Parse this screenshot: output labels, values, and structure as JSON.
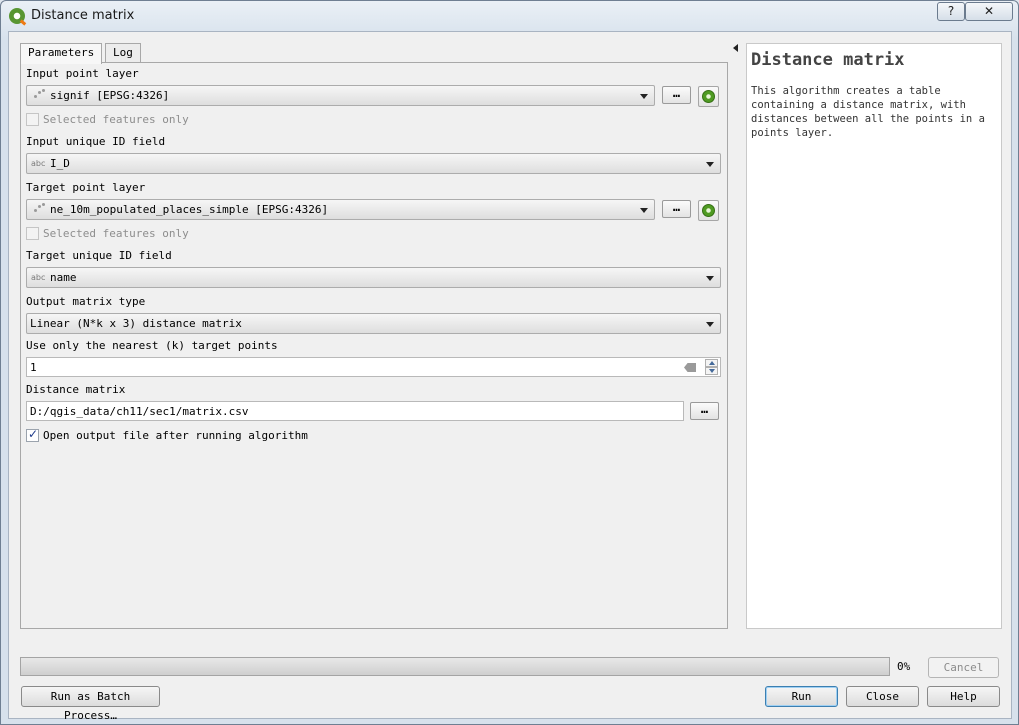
{
  "window": {
    "title": "Distance matrix",
    "help_button": "?",
    "close_button": "✕"
  },
  "tabs": [
    {
      "label": "Parameters",
      "active": true
    },
    {
      "label": "Log",
      "active": false
    }
  ],
  "form": {
    "input_layer": {
      "label": "Input point layer",
      "value": "signif [EPSG:4326]",
      "browse_label": "…",
      "selected_only_label": "Selected features only",
      "selected_only_checked": false
    },
    "input_id": {
      "label": "Input unique ID field",
      "value": "I_D",
      "type_icon": "abc"
    },
    "target_layer": {
      "label": "Target point layer",
      "value": "ne_10m_populated_places_simple [EPSG:4326]",
      "browse_label": "…",
      "selected_only_label": "Selected features only",
      "selected_only_checked": false
    },
    "target_id": {
      "label": "Target unique ID field",
      "value": "name",
      "type_icon": "abc"
    },
    "matrix_type": {
      "label": "Output matrix type",
      "value": "Linear (N*k x 3) distance matrix"
    },
    "nearest_k": {
      "label": "Use only the nearest (k) target points",
      "value": "1"
    },
    "output": {
      "label": "Distance matrix",
      "value": "D:/qgis_data/ch11/sec1/matrix.csv",
      "browse_label": "…"
    },
    "open_after": {
      "label": "Open output file after running algorithm",
      "checked": true
    }
  },
  "help": {
    "title": "Distance matrix",
    "description": "This algorithm creates a table containing a distance matrix, with distances between all the points in a points layer."
  },
  "progress": {
    "percent_label": "0%",
    "value": 0
  },
  "buttons": {
    "cancel": "Cancel",
    "batch": "Run as Batch Process…",
    "run": "Run",
    "close": "Close",
    "help": "Help"
  }
}
